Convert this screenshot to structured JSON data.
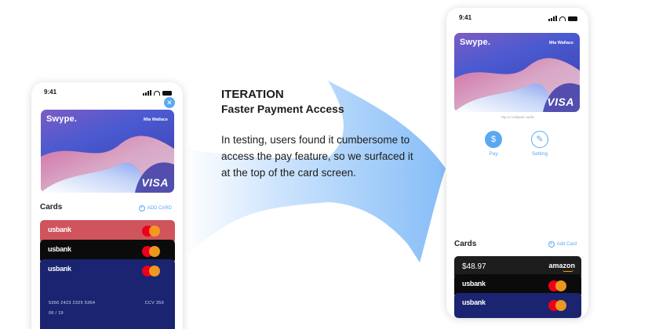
{
  "colors": {
    "accent": "#5aa9f0",
    "arrow": "#a9d1fb",
    "card_red": "#cf545c",
    "card_black": "#0b0b0b",
    "card_navy": "#1a2471",
    "mastercard_red": "#eb001b",
    "mastercard_yellow": "#f79e1b"
  },
  "caption": {
    "title": "ITERATION",
    "subtitle": "Faster Payment Access",
    "body": "In testing, users found it cumbersome to access the pay feature, so we surfaced it at the top of the card screen."
  },
  "left_phone": {
    "time": "9:41",
    "close_icon": "close-icon",
    "card": {
      "brand": "Swype.",
      "holder": "Mia Wallace",
      "network": "VISA"
    },
    "cards_title": "Cards",
    "add_card": "ADD CARD",
    "stack": [
      {
        "bank": "usbank",
        "color": "#cf545c"
      },
      {
        "bank": "usbank",
        "color": "#0b0b0b"
      },
      {
        "bank": "usbank",
        "color": "#1a2471",
        "number": "5366 2423 2325 5364",
        "expiry": "06 / 19",
        "ccv": "CCV 359"
      }
    ]
  },
  "right_phone": {
    "time": "9:41",
    "card": {
      "brand": "Swype.",
      "holder": "Mia Wallace",
      "network": "VISA"
    },
    "hint": "Tap to collapse cards",
    "actions": [
      {
        "label": "Pay",
        "icon": "dollar-icon"
      },
      {
        "label": "Setting",
        "icon": "wrench-icon"
      }
    ],
    "cards_title": "Cards",
    "add_card": "Add Card",
    "stack": [
      {
        "amount": "$48.97",
        "merchant": "amazon",
        "color": "#1d1d1d"
      },
      {
        "bank": "usbank",
        "color": "#0b0b0b"
      },
      {
        "bank": "usbank",
        "color": "#1a2471"
      }
    ]
  }
}
